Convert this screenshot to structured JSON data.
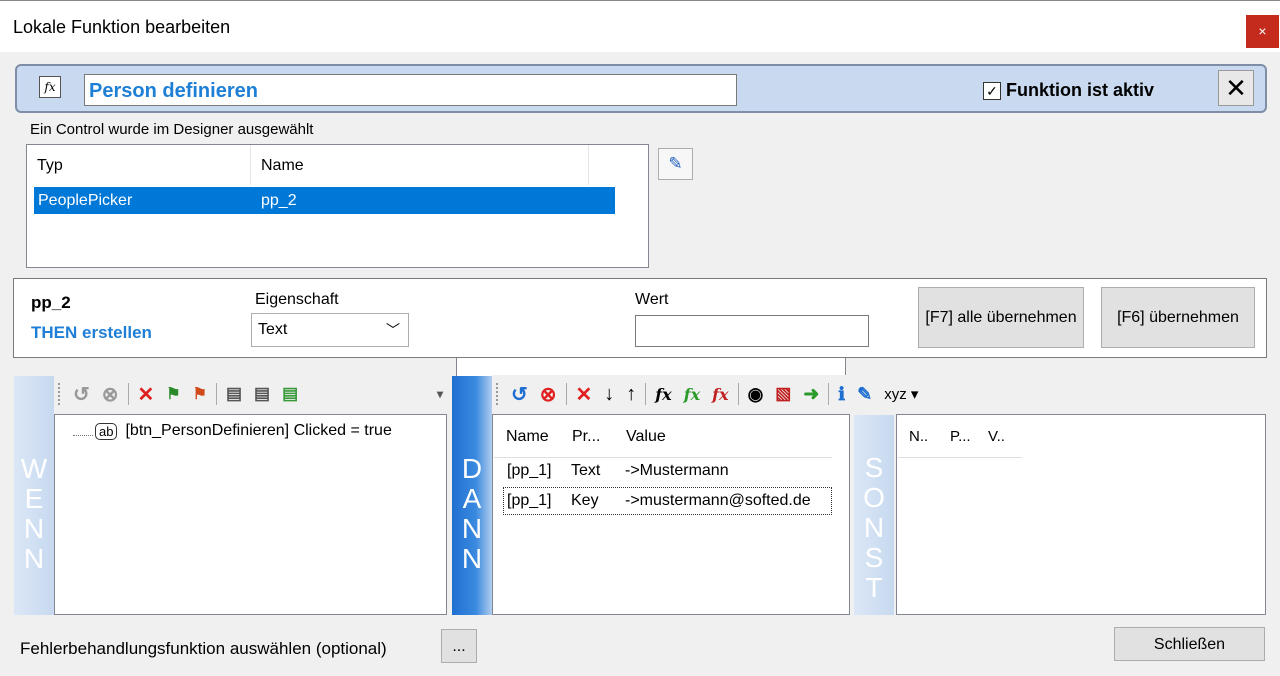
{
  "window": {
    "title": "Lokale Funktion bearbeiten",
    "close_glyph": "×"
  },
  "header": {
    "function_name": "Person definieren",
    "active_label": "Funktion ist aktiv",
    "active_checked": true,
    "check_glyph": "✓",
    "close_glyph": "✕"
  },
  "controls": {
    "caption": "Ein Control wurde im Designer ausgewählt",
    "columns": [
      "Typ",
      "Name"
    ],
    "rows": [
      {
        "typ": "PeoplePicker",
        "name": "pp_2",
        "selected": true
      }
    ]
  },
  "property": {
    "control_name": "pp_2",
    "mode": "THEN erstellen",
    "eigenschaft_label": "Eigenschaft",
    "eigenschaft_value": "Text",
    "wert_label": "Wert",
    "wert_value": "",
    "apply_all_label": "[F7] alle übernehmen",
    "apply_label": "[F6] übernehmen"
  },
  "wenn": {
    "strip_letters": [
      "W",
      "E",
      "N",
      "N"
    ],
    "condition": "[btn_PersonDefinieren] Clicked = true",
    "condition_badge": "ab"
  },
  "dann": {
    "strip_letters": [
      "D",
      "A",
      "N",
      "N"
    ],
    "columns": [
      "Name",
      "Pr...",
      "Value"
    ],
    "rows": [
      {
        "name": "[pp_1]",
        "prop": "Text",
        "value": "->Mustermann"
      },
      {
        "name": "[pp_1]",
        "prop": "Key",
        "value": "->mustermann@softed.de"
      }
    ],
    "toolbar_extra_label": "xyz"
  },
  "sonst": {
    "strip_letters": [
      "S",
      "O",
      "N",
      "S",
      "T"
    ],
    "columns": [
      "N..",
      "P...",
      "V.."
    ]
  },
  "footer": {
    "error_handler_label": "Fehlerbehandlungsfunktion auswählen (optional)",
    "ellipsis_label": "...",
    "close_label": "Schließen"
  },
  "colors": {
    "accent": "#1e7fd6",
    "selection": "#0078d7",
    "header_bg": "#c9daf0",
    "dann_strip": "#1f6fd1"
  }
}
